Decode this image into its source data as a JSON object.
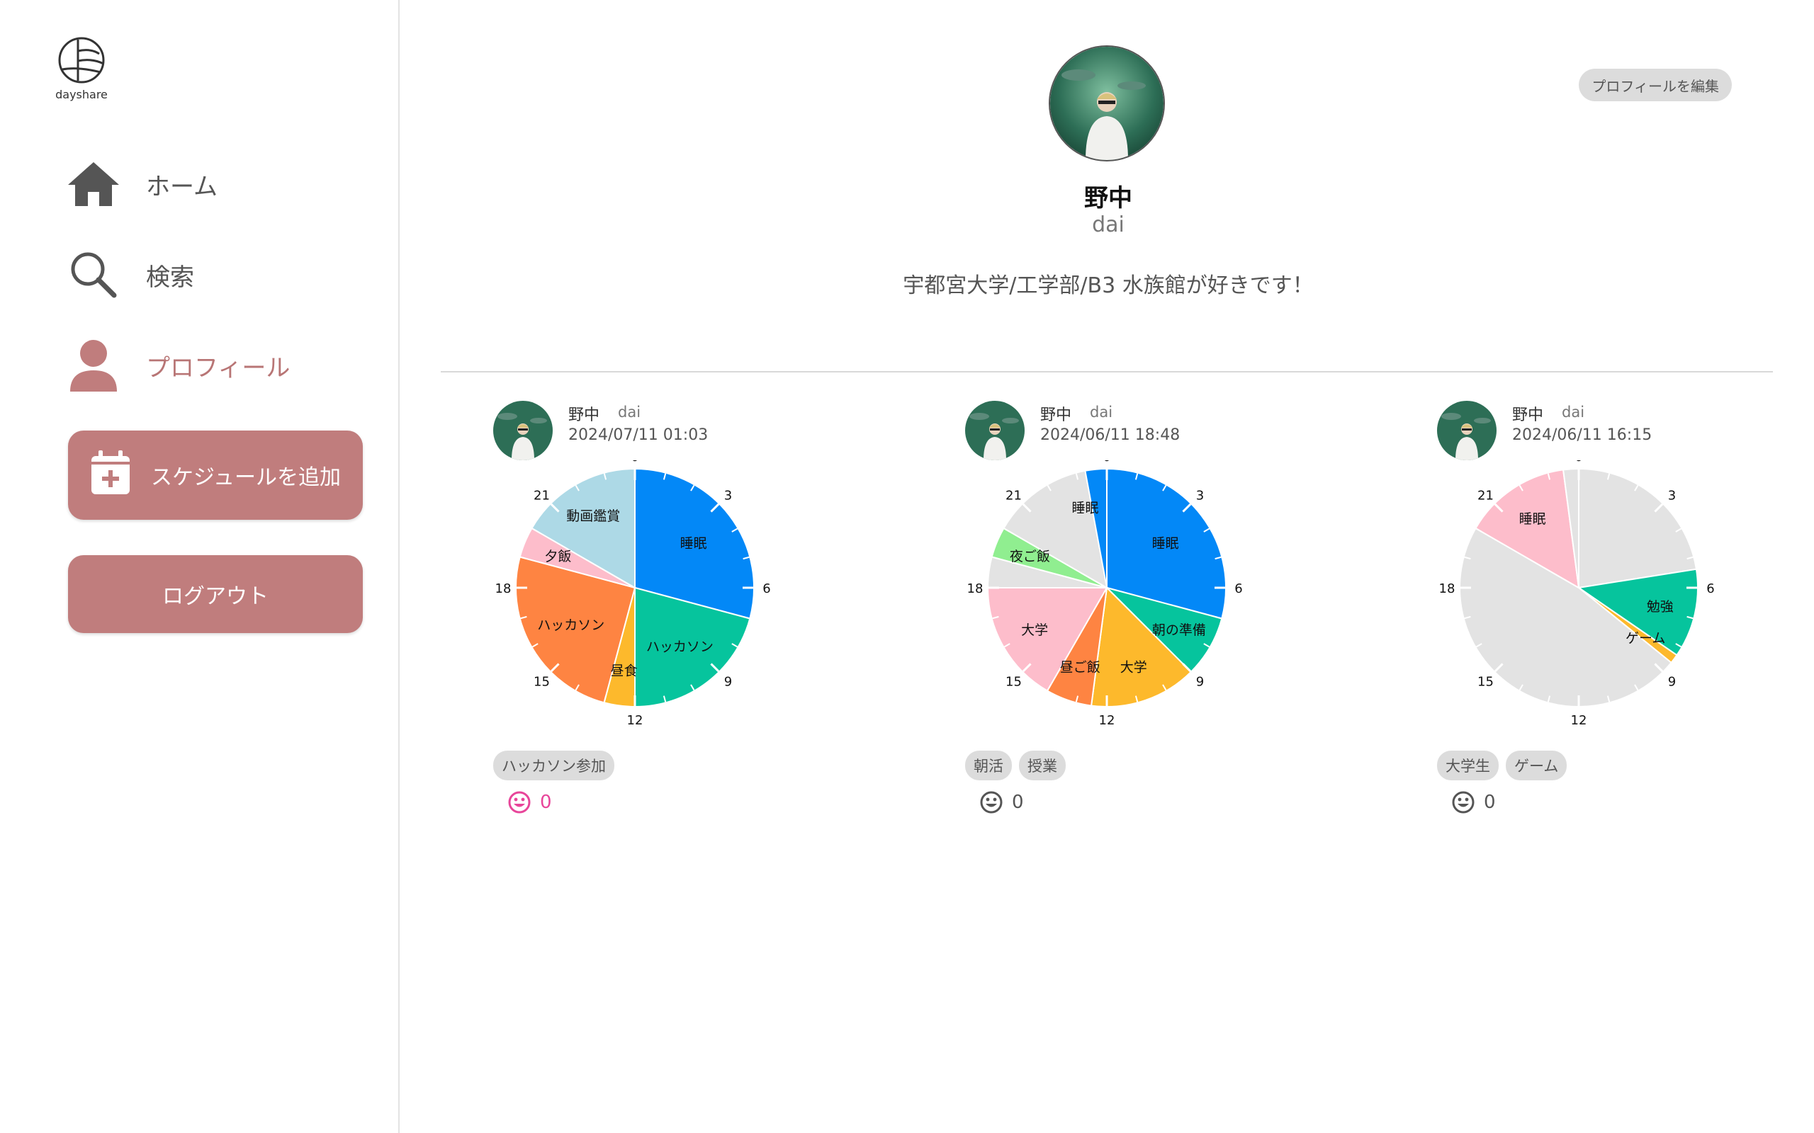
{
  "app": {
    "logo_text": "dayshare"
  },
  "sidebar": {
    "items": [
      {
        "label": "ホーム",
        "icon": "home-icon"
      },
      {
        "label": "検索",
        "icon": "search-icon"
      },
      {
        "label": "プロフィール",
        "icon": "user-icon",
        "active": true
      }
    ],
    "add_schedule_label": "スケジュールを追加",
    "logout_label": "ログアウト"
  },
  "profile": {
    "edit_label": "プロフィールを編集",
    "name": "野中",
    "id": "dai",
    "bio": "宇都宮大学/工学部/B3 水族館が好きです！"
  },
  "colors": {
    "accent": "#c07d7d",
    "active_text": "#b87575",
    "like_pink": "#e8459a"
  },
  "posts": [
    {
      "name": "野中",
      "id": "dai",
      "date": "2024/07/11 01:03",
      "tags": [
        "ハッカソン参加"
      ],
      "likes": "0",
      "like_active": true,
      "chart_data": {
        "type": "pie",
        "hour_ticks": [
          "0",
          "3",
          "6",
          "9",
          "12",
          "15",
          "18",
          "21"
        ],
        "segments": [
          {
            "label": "睡眠",
            "start": 0,
            "end": 7,
            "color": "#0388f7"
          },
          {
            "label": "ハッカソン",
            "start": 7,
            "end": 12,
            "color": "#06c49d"
          },
          {
            "label": "昼食",
            "start": 12,
            "end": 13,
            "color": "#fdb92c"
          },
          {
            "label": "ハッカソン",
            "start": 13,
            "end": 19,
            "color": "#fe8442"
          },
          {
            "label": "夕飯",
            "start": 19,
            "end": 20,
            "color": "#fdbdcb"
          },
          {
            "label": "動画鑑賞",
            "start": 20,
            "end": 24,
            "color": "#add9e6"
          }
        ]
      }
    },
    {
      "name": "野中",
      "id": "dai",
      "date": "2024/06/11 18:48",
      "tags": [
        "朝活",
        "授業"
      ],
      "likes": "0",
      "like_active": false,
      "chart_data": {
        "type": "pie",
        "hour_ticks": [
          "0",
          "3",
          "6",
          "9",
          "12",
          "15",
          "18",
          "21"
        ],
        "segments": [
          {
            "label": "睡眠",
            "start": 0,
            "end": 7,
            "color": "#0388f7"
          },
          {
            "label": "朝の準備",
            "start": 7,
            "end": 9,
            "color": "#06c49d"
          },
          {
            "label": "大学",
            "start": 9,
            "end": 12.5,
            "color": "#fdb92c"
          },
          {
            "label": "昼ご飯",
            "start": 12.5,
            "end": 14,
            "color": "#fe8442"
          },
          {
            "label": "大学",
            "start": 14,
            "end": 18,
            "color": "#fdbdcb"
          },
          {
            "label": "",
            "start": 18,
            "end": 19,
            "color": "#e3e3e3"
          },
          {
            "label": "夜ご飯",
            "start": 19,
            "end": 20,
            "color": "#90ee90"
          },
          {
            "label": "",
            "start": 20,
            "end": 23.7,
            "color": "#e3e3e3"
          },
          {
            "label": "睡眠",
            "start": 23.3,
            "end": 24,
            "color": "#0388f7",
            "label_pos": 23.0
          }
        ]
      }
    },
    {
      "name": "野中",
      "id": "dai",
      "date": "2024/06/11 16:15",
      "tags": [
        "大学生",
        "ゲーム"
      ],
      "likes": "0",
      "like_active": false,
      "chart_data": {
        "type": "pie",
        "hour_ticks": [
          "0",
          "3",
          "6",
          "9",
          "12",
          "15",
          "18",
          "21"
        ],
        "segments": [
          {
            "label": "",
            "start": 0,
            "end": 5.4,
            "color": "#e3e3e3"
          },
          {
            "label": "勉強",
            "start": 5.4,
            "end": 8.3,
            "color": "#06c49d"
          },
          {
            "label": "ゲーム",
            "start": 8.3,
            "end": 8.6,
            "color": "#fdb92c"
          },
          {
            "label": "",
            "start": 8.6,
            "end": 20,
            "color": "#e3e3e3"
          },
          {
            "label": "睡眠",
            "start": 20,
            "end": 23.5,
            "color": "#fdbdcb"
          },
          {
            "label": "",
            "start": 23.5,
            "end": 24,
            "color": "#e3e3e3"
          }
        ]
      }
    }
  ]
}
